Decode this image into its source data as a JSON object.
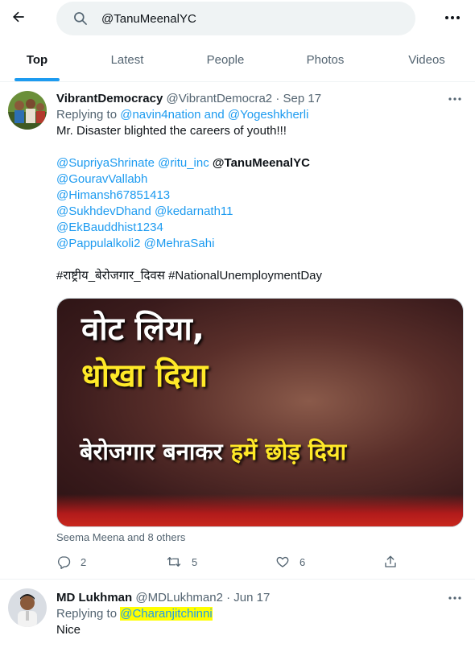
{
  "search": {
    "query": "@TanuMeenalYC"
  },
  "tabs": [
    "Top",
    "Latest",
    "People",
    "Photos",
    "Videos"
  ],
  "tweets": [
    {
      "name": "VibrantDemocracy",
      "handle": "@VibrantDemocra2",
      "date": "Sep 17",
      "replying_prefix": "Replying to",
      "replying_to": "@navin4nation and @Yogeshkherli",
      "text": "Mr. Disaster blighted the careers of youth!!!",
      "mention_lines": [
        [
          "@SupriyaShrinate",
          "@ritu_inc",
          "@TanuMeenalYC"
        ],
        [
          "@GouravVallabh"
        ],
        [
          "@Himansh67851413"
        ],
        [
          "@SukhdevDhand",
          "@kedarnath11"
        ],
        [
          "@EkBauddhist1234"
        ],
        [
          "@Pappulalkoli2",
          "@MehraSahi"
        ]
      ],
      "hashtags": "#राष्ट्रीय_बेरोजगार_दिवस #NationalUnemploymentDay",
      "image_text": {
        "line1": "वोट लिया,",
        "line2": "धोखा दिया",
        "line3a": "बेरोजगार बनाकर ",
        "line3b": "हमें छोड़ दिया"
      },
      "liked_by": "Seema Meena and 8 others",
      "stats": {
        "replies": "2",
        "retweets": "5",
        "likes": "6"
      }
    },
    {
      "name": "MD Lukhman",
      "handle": "@MDLukhman2",
      "date": "Jun 17",
      "replying_prefix": "Replying to",
      "replying_to": "@Charanjitchinni",
      "text": "Nice"
    }
  ],
  "colors": {
    "accent": "#1d9bf0",
    "secondary_text": "#536471",
    "highlight": "#ffff00"
  }
}
